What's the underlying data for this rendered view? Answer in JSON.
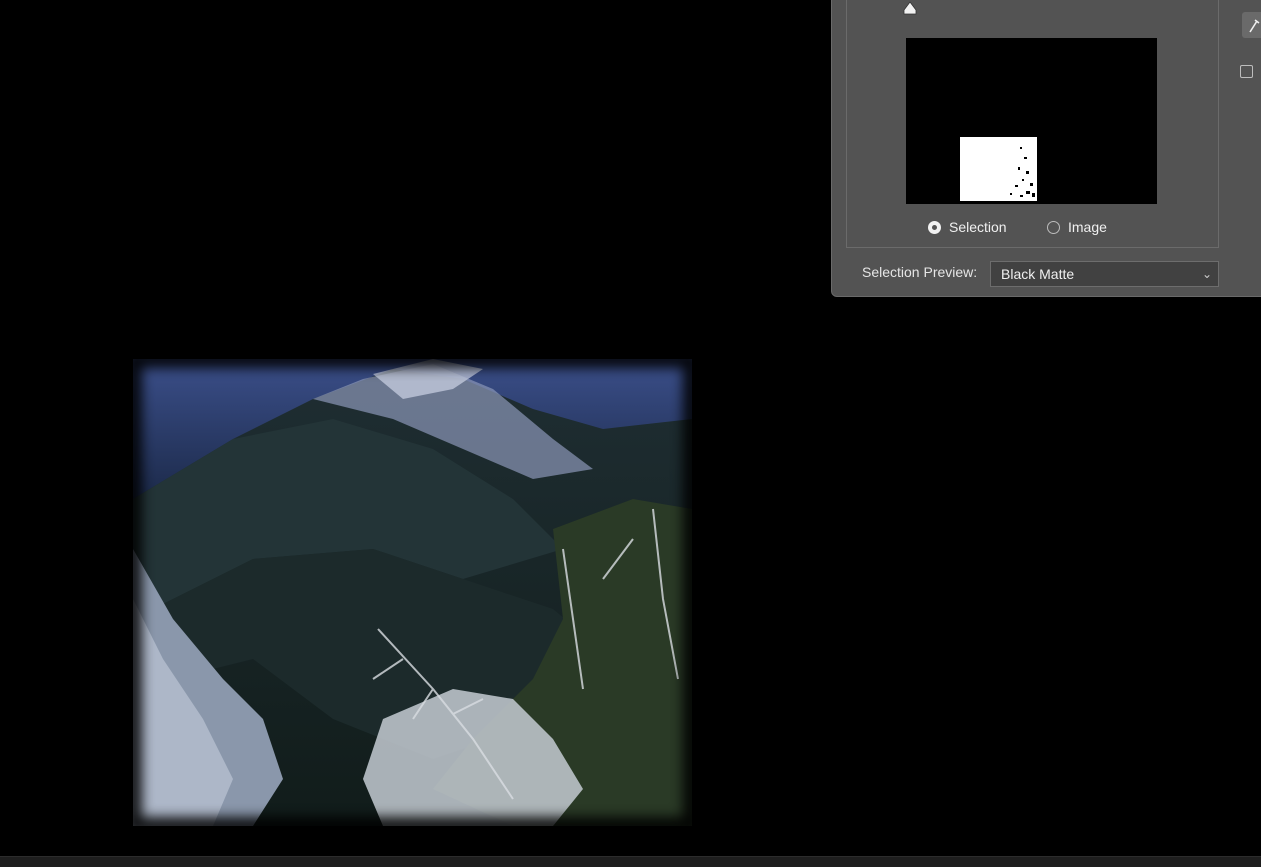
{
  "dialog": {
    "view_options": [
      {
        "label": "Selection",
        "checked": true
      },
      {
        "label": "Image",
        "checked": false
      }
    ],
    "selection_preview": {
      "label": "Selection Preview:",
      "value": "Black Matte"
    }
  },
  "icons": {
    "slider_thumb": "triangle-slider-icon",
    "eyedropper": "eyedropper-icon",
    "dropdown": "chevron-down-icon"
  },
  "colors": {
    "canvas_bg": "#000000",
    "panel_bg": "#535353"
  }
}
